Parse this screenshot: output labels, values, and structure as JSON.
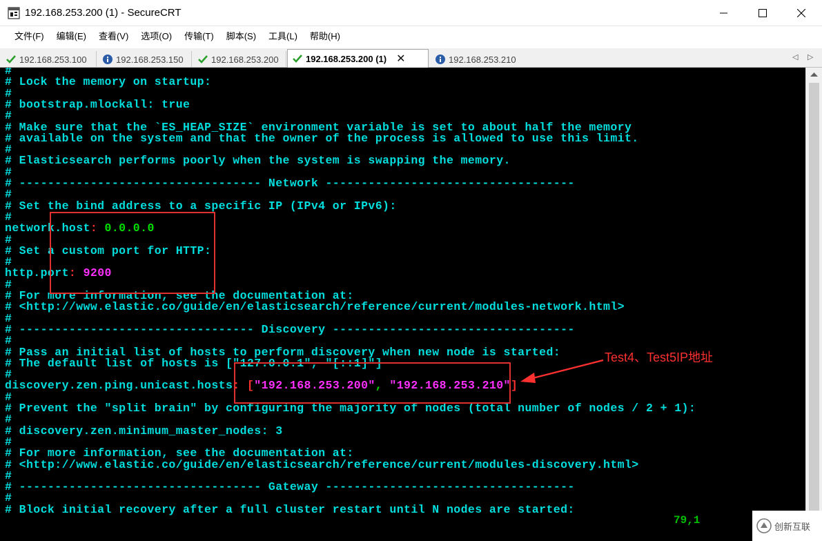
{
  "window": {
    "title": "192.168.253.200 (1) - SecureCRT",
    "minimize_icon": "minimize-icon",
    "maximize_icon": "maximize-icon",
    "close_icon": "close-icon"
  },
  "menu": [
    "文件(F)",
    "编辑(E)",
    "查看(V)",
    "选项(O)",
    "传输(T)",
    "脚本(S)",
    "工具(L)",
    "帮助(H)"
  ],
  "tabs": [
    {
      "label": "192.168.253.100",
      "status": "check",
      "active": false
    },
    {
      "label": "192.168.253.150",
      "status": "info",
      "active": false
    },
    {
      "label": "192.168.253.200",
      "status": "check",
      "active": false
    },
    {
      "label": "192.168.253.200 (1)",
      "status": "check",
      "active": true,
      "close": "✕"
    },
    {
      "label": "192.168.253.210",
      "status": "info",
      "active": false
    }
  ],
  "terminal": {
    "lines": [
      "#",
      "# Lock the memory on startup:",
      "#",
      "# bootstrap.mlockall: true",
      "#",
      "# Make sure that the `ES_HEAP_SIZE` environment variable is set to about half the memory",
      "# available on the system and that the owner of the process is allowed to use this limit.",
      "#",
      "# Elasticsearch performs poorly when the system is swapping the memory.",
      "#",
      "# ---------------------------------- Network -----------------------------------",
      "#",
      "# Set the bind address to a specific IP (IPv4 or IPv6):",
      "#",
      {
        "key": "network.host",
        "sep": ": ",
        "value": "0.0.0.0",
        "value_color": "green"
      },
      "#",
      "# Set a custom port for HTTP:",
      "#",
      {
        "key": "http.port",
        "sep": ": ",
        "value": "9200",
        "value_color": "magenta"
      },
      "#",
      "# For more information, see the documentation at:",
      "# <http://www.elastic.co/guide/en/elasticsearch/reference/current/modules-network.html>",
      "#",
      "# --------------------------------- Discovery ----------------------------------",
      "#",
      "# Pass an initial list of hosts to perform discovery when new node is started:",
      "# The default list of hosts is [\"127.0.0.1\", \"[::1]\"]",
      "#",
      {
        "key": "discovery.zen.ping.unicast.hosts",
        "sep": ": ",
        "hosts": [
          "\"192.168.253.200\"",
          "\"192.168.253.210\""
        ]
      },
      "#",
      "# Prevent the \"split brain\" by configuring the majority of nodes (total number of nodes / 2 + 1):",
      "#",
      "# discovery.zen.minimum_master_nodes: 3",
      "#",
      "# For more information, see the documentation at:",
      "# <http://www.elastic.co/guide/en/elasticsearch/reference/current/modules-discovery.html>",
      "#",
      "# ---------------------------------- Gateway -----------------------------------",
      "#",
      "# Block initial recovery after a full cluster restart until N nodes are started:"
    ],
    "cursor_position": "79,1"
  },
  "annotation": {
    "text": "Test4、Test5IP地址",
    "color": "#ff3030"
  },
  "watermark": {
    "text": "创新互联"
  },
  "colors": {
    "terminal_bg": "#000000",
    "terminal_text": "#00dede",
    "value_green": "#00e000",
    "value_magenta": "#ff30ff",
    "punct_red": "#ff3030",
    "highlight_box": "#e03030"
  }
}
